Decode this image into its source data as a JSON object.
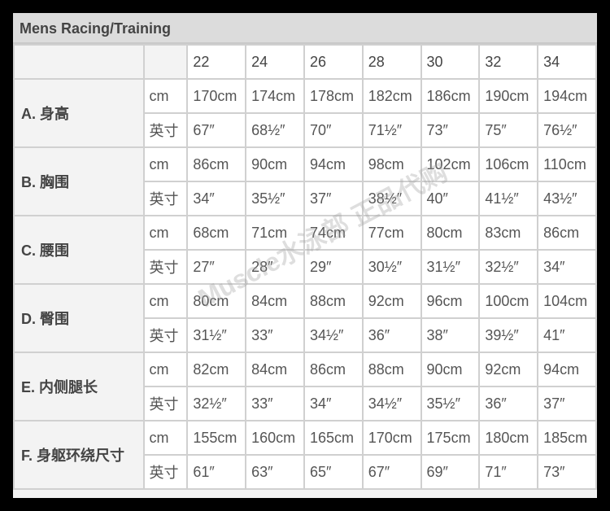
{
  "title": "Mens Racing/Training",
  "sizes": [
    "22",
    "24",
    "26",
    "28",
    "30",
    "32",
    "34"
  ],
  "rows": [
    {
      "label": "A. 身高",
      "cm": [
        "170cm",
        "174cm",
        "178cm",
        "182cm",
        "186cm",
        "190cm",
        "194cm"
      ],
      "in": [
        "67″",
        "68½″",
        "70″",
        "71½″",
        "73″",
        "75″",
        "76½″"
      ]
    },
    {
      "label": "B. 胸围",
      "cm": [
        "86cm",
        "90cm",
        "94cm",
        "98cm",
        "102cm",
        "106cm",
        "110cm"
      ],
      "in": [
        "34″",
        "35½″",
        "37″",
        "38½″",
        "40″",
        "41½″",
        "43½″"
      ]
    },
    {
      "label": "C. 腰围",
      "cm": [
        "68cm",
        "71cm",
        "74cm",
        "77cm",
        "80cm",
        "83cm",
        "86cm"
      ],
      "in": [
        "27″",
        "28″",
        "29″",
        "30½″",
        "31½″",
        "32½″",
        "34″"
      ]
    },
    {
      "label": "D. 臀围",
      "cm": [
        "80cm",
        "84cm",
        "88cm",
        "92cm",
        "96cm",
        "100cm",
        "104cm"
      ],
      "in": [
        "31½″",
        "33″",
        "34½″",
        "36″",
        "38″",
        "39½″",
        "41″"
      ]
    },
    {
      "label": "E. 内侧腿长",
      "cm": [
        "82cm",
        "84cm",
        "86cm",
        "88cm",
        "90cm",
        "92cm",
        "94cm"
      ],
      "in": [
        "32½″",
        "33″",
        "34″",
        "34½″",
        "35½″",
        "36″",
        "37″"
      ]
    },
    {
      "label": "F. 身躯环绕尺寸",
      "cm": [
        "155cm",
        "160cm",
        "165cm",
        "170cm",
        "175cm",
        "180cm",
        "185cm"
      ],
      "in": [
        "61″",
        "63″",
        "65″",
        "67″",
        "69″",
        "71″",
        "73″"
      ]
    }
  ],
  "unit_cm": "cm",
  "unit_in": "英寸",
  "watermark": "Muscle水泳部 正品代购"
}
